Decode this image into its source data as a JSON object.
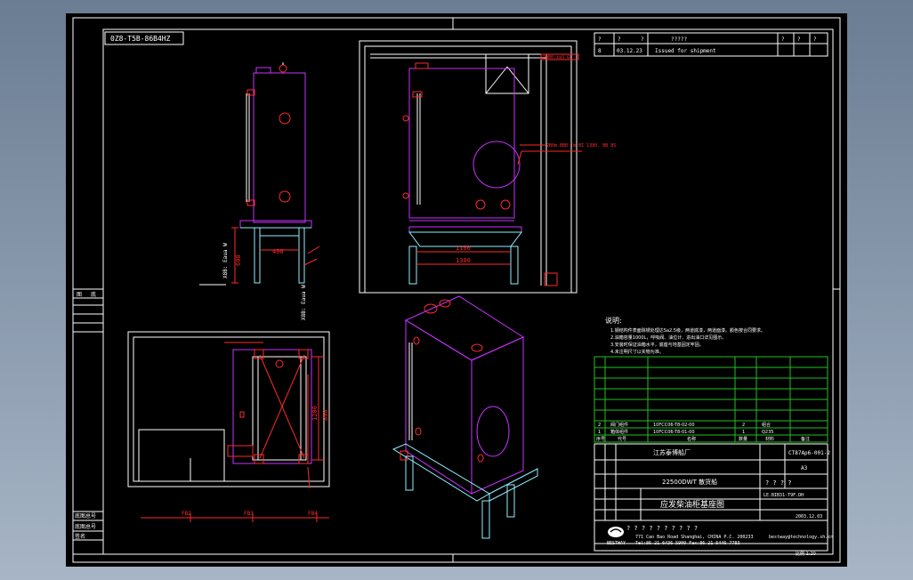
{
  "sheet": {
    "code_box": "0Z8-T5B-86B4HZ",
    "ref_label": "20B0.zaS GL",
    "ref_label2": "2B0m.BBB Tm BI 1380. BB BS",
    "side_labels": [
      "图",
      "底",
      "底图总号",
      "底图总号",
      "签名"
    ],
    "left_vertical_label": "X8B: Eaua W",
    "left_vertical_label2": "X8B: Eaua W",
    "bottom_label": "图纸"
  },
  "dimensions": {
    "side_400": "400",
    "side_600": "600",
    "front_1100": "1100",
    "front_1300": "1300",
    "plan_1200": "1200",
    "plan_800": "800",
    "axis_ticks": [
      "FB2",
      "FB3",
      "FB4"
    ]
  },
  "revision": {
    "headers": [
      "?",
      "?",
      "?",
      "?????",
      "?",
      "?",
      "?"
    ],
    "row": [
      "8",
      "03.12.23",
      "Issued for shipment"
    ]
  },
  "notes": {
    "title": "说明:",
    "lines": [
      "1.钢结构件表面除锈处理达Sa2.5级，两道底漆，两道面漆。颜色按合同要求。",
      "2.油箱容量1000L，呼吸阀、油位计、进出油口详见图示。",
      "3.安装时保证油箱水平，底座与地基固定牢固。",
      "4.未注明尺寸以实物为准。"
    ]
  },
  "parts_table": {
    "rows": [
      [
        "2",
        "阀门组件",
        "10FCC06-T8-02-00",
        "2",
        "组合",
        ""
      ],
      [
        "1",
        "箱体组件",
        "10FCC06-T8-01-00",
        "1",
        "Q235",
        ""
      ]
    ],
    "headers": [
      "序号",
      "代号",
      "名称",
      "数量",
      "材料",
      "备注"
    ]
  },
  "title_block": {
    "company": "江苏泰博船厂",
    "project": "22500DWT 散货船",
    "drawing_title": "应发柴油柜基座图",
    "drawing_no": "CT87Ap6-001-2",
    "sheet_no": "A3",
    "scale_label": "比例 1:20",
    "date": "2003.12.03",
    "qmarks": "? ? ? ?",
    "small_code": "LE.BIB31-T9F.DH",
    "company_en": "BESTWAY",
    "address": "771 Cao Bao Road Shanghai, CHINA   P.C. 200233",
    "contact": "Tel:86-21-6436 5900  Fax:86-21-6446 7783",
    "email": "bestway@technology.sh.cn",
    "page": "附图: 1/1 (??)",
    "question_row": "? ? ? ? ? ? ? ? ? ?"
  },
  "colors": {
    "background": "#000000",
    "white": "#ffffff",
    "red": "#ff2a2a",
    "magenta": "#c832ff",
    "cyan": "#8ff0ff",
    "green": "#22c022",
    "yellow": "#f0f000"
  }
}
